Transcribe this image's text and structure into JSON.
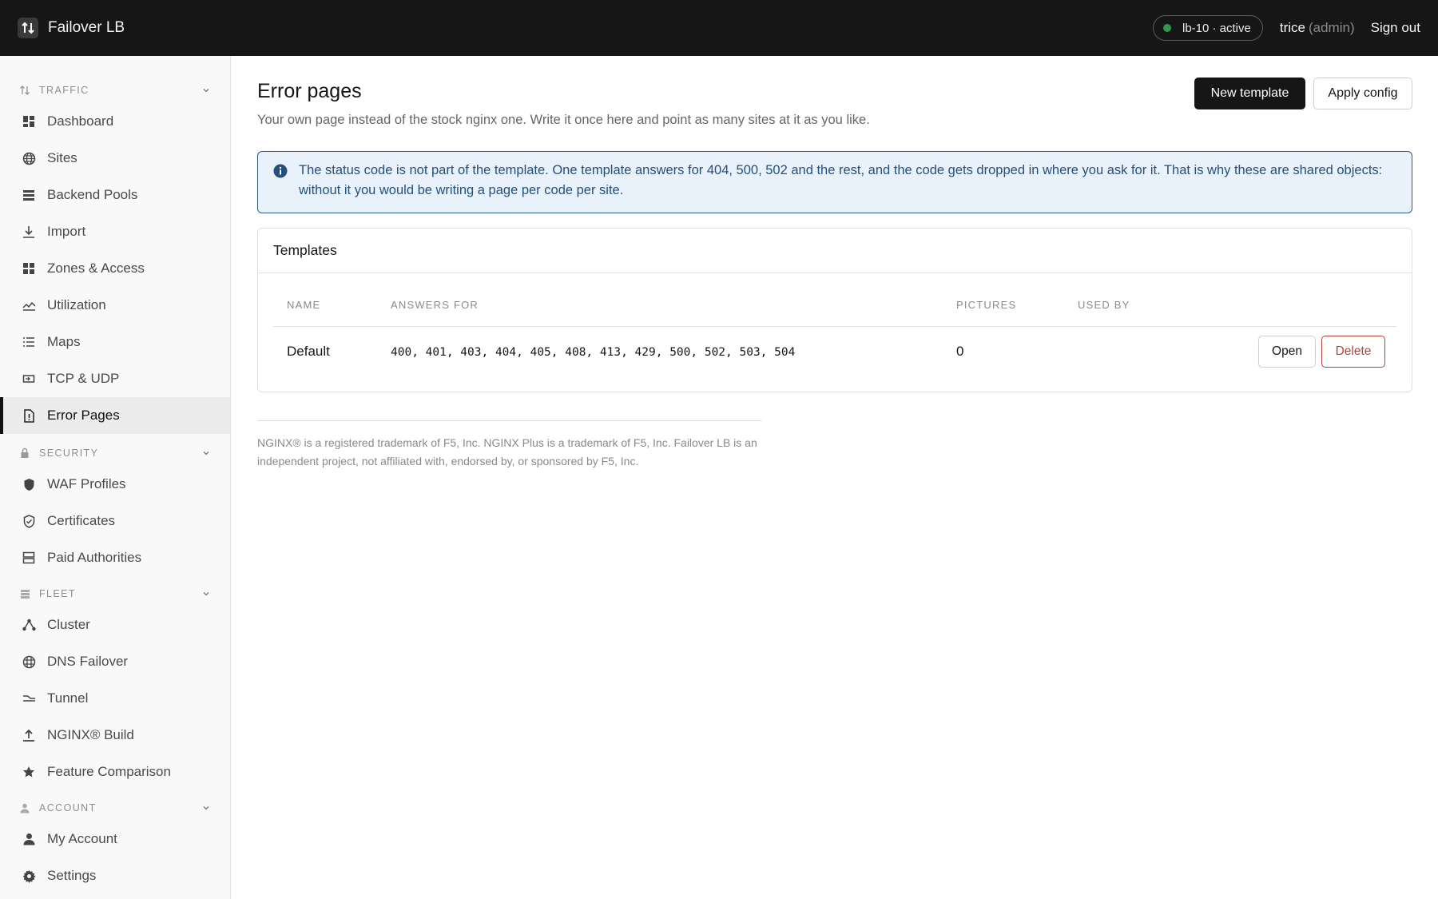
{
  "app": {
    "title": "Failover LB"
  },
  "header": {
    "status": "lb-10 · active",
    "status_color": "#2e9a4a",
    "user": "trice",
    "user_role": "(admin)",
    "signout_label": "Sign out"
  },
  "sidebar": {
    "sections": [
      {
        "label": "TRAFFIC",
        "icon": "sort-arrows-icon"
      },
      {
        "label": "SECURITY",
        "icon": "lock-icon"
      },
      {
        "label": "FLEET",
        "icon": "server-icon"
      },
      {
        "label": "ACCOUNT",
        "icon": "user-icon"
      }
    ],
    "items": [
      {
        "label": "Dashboard",
        "icon": "dashboard-icon"
      },
      {
        "label": "Sites",
        "icon": "globe-icon"
      },
      {
        "label": "Backend Pools",
        "icon": "stack-icon"
      },
      {
        "label": "Import",
        "icon": "download-icon"
      },
      {
        "label": "Zones & Access",
        "icon": "grid-icon"
      },
      {
        "label": "Utilization",
        "icon": "chart-line-icon"
      },
      {
        "label": "Maps",
        "icon": "list-icon"
      },
      {
        "label": "TCP & UDP",
        "icon": "port-icon"
      },
      {
        "label": "Error Pages",
        "icon": "file-alert-icon",
        "active": true
      },
      {
        "label": "WAF Profiles",
        "icon": "shield-icon"
      },
      {
        "label": "Certificates",
        "icon": "shield-check-icon"
      },
      {
        "label": "Paid Authorities",
        "icon": "server-icon"
      },
      {
        "label": "Cluster",
        "icon": "cluster-icon"
      },
      {
        "label": "DNS Failover",
        "icon": "globe-network-icon"
      },
      {
        "label": "Tunnel",
        "icon": "tunnel-icon"
      },
      {
        "label": "NGINX® Build",
        "icon": "upload-icon"
      },
      {
        "label": "Feature Comparison",
        "icon": "star-icon"
      },
      {
        "label": "My Account",
        "icon": "person-icon"
      },
      {
        "label": "Settings",
        "icon": "gear-icon"
      }
    ]
  },
  "main": {
    "title": "Error pages",
    "subtitle": "Your own page instead of the stock nginx one. Write it once here and point as many sites at it as you like.",
    "new_template_label": "New template",
    "apply_config_label": "Apply config",
    "info": "The status code is not part of the template. One template answers for 404, 500, 502 and the rest, and the code gets dropped in where you ask for it. That is why these are shared objects: without it you would be writing a page per code per site.",
    "info_color": "#24507e",
    "templates": {
      "title": "Templates",
      "columns": [
        "NAME",
        "ANSWERS FOR",
        "PICTURES",
        "USED BY"
      ],
      "rows": [
        {
          "name": "Default",
          "answers_for": "400, 401, 403, 404, 405, 408, 413, 429, 500, 502, 503, 504",
          "pictures": "0",
          "used_by": ""
        }
      ],
      "open_label": "Open",
      "delete_label": "Delete",
      "delete_color": "#b8413b"
    },
    "legal": "NGINX® is a registered trademark of F5, Inc. NGINX Plus is a trademark of F5, Inc. Failover LB is an independent project, not affiliated with, endorsed by, or sponsored by F5, Inc."
  }
}
